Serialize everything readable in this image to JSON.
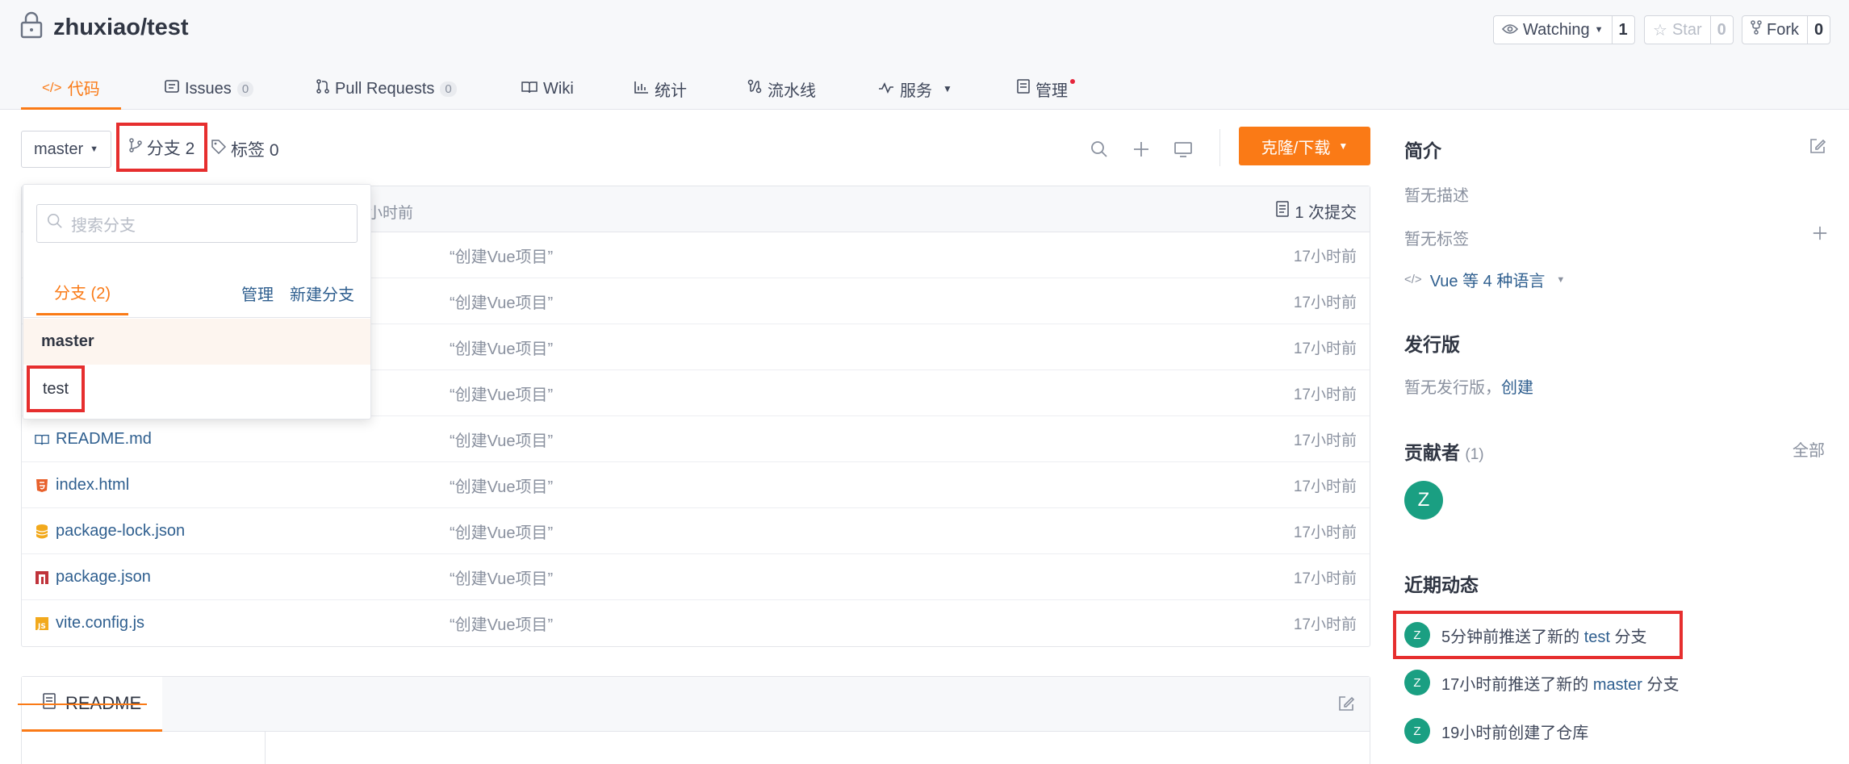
{
  "repo": {
    "title": "zhuxiao/test",
    "watch_label": "Watching",
    "watch_count": "1",
    "star_label": "Star",
    "star_count": "0",
    "fork_label": "Fork",
    "fork_count": "0"
  },
  "tabs": [
    {
      "label": "代码"
    },
    {
      "label": "Issues",
      "badge": "0"
    },
    {
      "label": "Pull Requests",
      "badge": "0"
    },
    {
      "label": "Wiki"
    },
    {
      "label": "统计"
    },
    {
      "label": "流水线"
    },
    {
      "label": "服务"
    },
    {
      "label": "管理"
    }
  ],
  "toolbar": {
    "branch": "master",
    "branches_label": "分支 2",
    "tags_label": "标签 0",
    "clone_label": "克隆/下载"
  },
  "files": {
    "header_time": "小时前",
    "commit_count": "1 次提交",
    "rows": [
      {
        "name": "",
        "message": "“创建Vue项目”",
        "time": "17小时前"
      },
      {
        "name": "",
        "message": "“创建Vue项目”",
        "time": "17小时前"
      },
      {
        "name": "",
        "message": "“创建Vue项目”",
        "time": "17小时前"
      },
      {
        "name": "",
        "message": "“创建Vue项目”",
        "time": "17小时前"
      },
      {
        "name": "README.md",
        "message": "“创建Vue项目”",
        "time": "17小时前"
      },
      {
        "name": "index.html",
        "message": "“创建Vue项目”",
        "time": "17小时前"
      },
      {
        "name": "package-lock.json",
        "message": "“创建Vue项目”",
        "time": "17小时前"
      },
      {
        "name": "package.json",
        "message": "“创建Vue项目”",
        "time": "17小时前"
      },
      {
        "name": "vite.config.js",
        "message": "“创建Vue项目”",
        "time": "17小时前"
      }
    ]
  },
  "readme": {
    "title": "README"
  },
  "dropdown": {
    "search_placeholder": "搜索分支",
    "tab_label": "分支 (2)",
    "manage": "管理",
    "new_branch": "新建分支",
    "branches": [
      "master",
      "test"
    ]
  },
  "sidebar": {
    "intro_title": "简介",
    "no_desc": "暂无描述",
    "no_tags": "暂无标签",
    "languages": "Vue 等 4 种语言",
    "release_title": "发行版",
    "no_release": "暂无发行版，",
    "create": "创建",
    "contrib_title": "贡献者",
    "contrib_count": "(1)",
    "all": "全部",
    "contrib_avatar": "Z",
    "activity_title": "近期动态",
    "activities": [
      {
        "avatar": "Z",
        "pre": "5分钟前推送了新的",
        "link": "test",
        "post": "分支"
      },
      {
        "avatar": "Z",
        "pre": "17小时前推送了新的",
        "link": "master",
        "post": "分支"
      },
      {
        "avatar": "Z",
        "pre": "19小时前创建了仓库",
        "link": "",
        "post": ""
      }
    ]
  },
  "colors": {
    "accent": "#fa7a16",
    "link": "#2f5f8f",
    "highlight": "#e62e2e",
    "avatar": "#1a9f82"
  }
}
